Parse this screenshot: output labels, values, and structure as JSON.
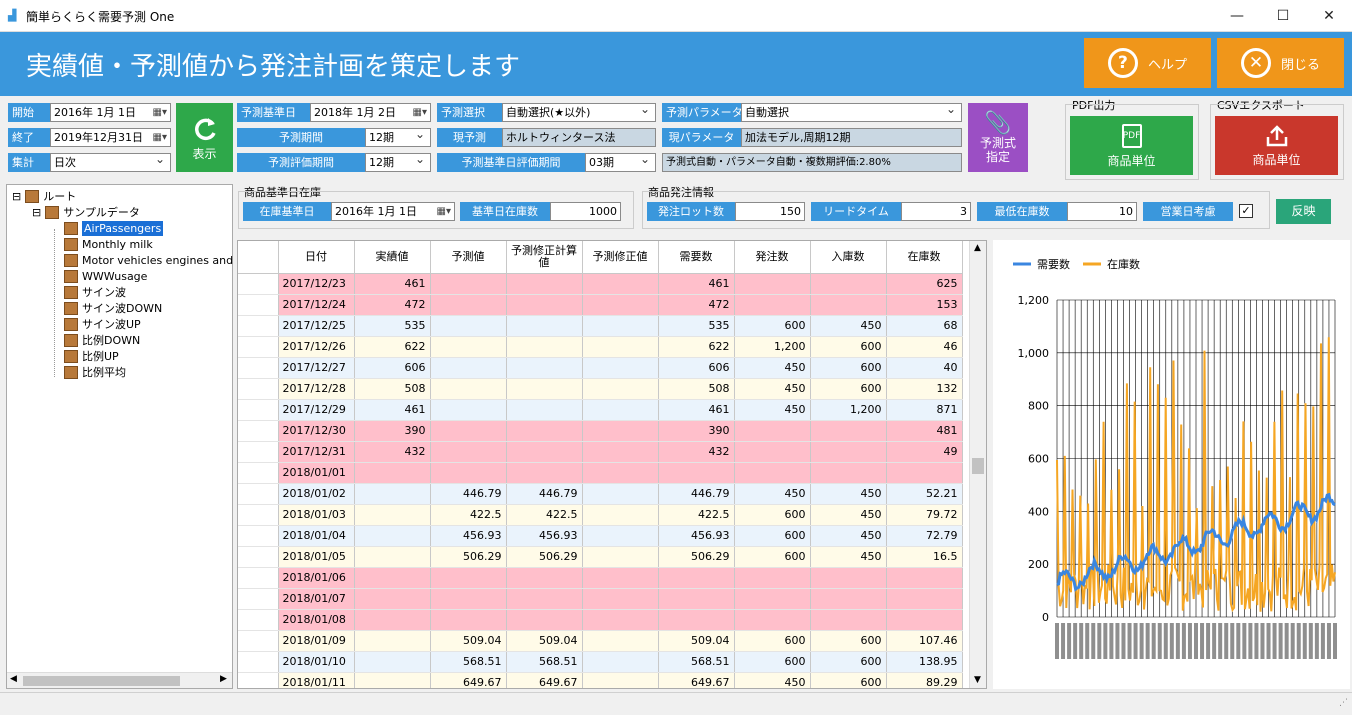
{
  "window": {
    "title": "簡単らくらく需要予測 One",
    "minimize": "—",
    "maximize": "☐",
    "close": "✕"
  },
  "header": {
    "title": "実績値・予測値から発注計画を策定します",
    "help_label": "ヘルプ",
    "close_label": "閉じる",
    "help_icon": "?",
    "close_icon": "✕"
  },
  "params": {
    "start_label": "開始",
    "start_value": "2016年  1月  1日",
    "end_label": "終了",
    "end_value": "2019年12月31日",
    "agg_label": "集計",
    "agg_value": "日次",
    "refresh_label": "表示",
    "forecast_base_label": "予測基準日",
    "forecast_base_value": "2018年  1月  2日",
    "forecast_period_label": "予測期間",
    "forecast_period_value": "12期",
    "eval_period_label": "予測評価期間",
    "eval_period_value": "12期",
    "forecast_select_label": "予測選択",
    "forecast_select_value": "自動選択(★以外)",
    "current_forecast_label": "現予測",
    "current_forecast_value": "ホルトウィンタース法",
    "base_eval_label": "予測基準日評価期間",
    "base_eval_value": "03期",
    "param_label": "予測パラメータ",
    "param_value": "自動選択",
    "current_param_label": "現パラメータ",
    "current_param_value": "加法モデル,周期12期",
    "formula_value": "予測式自動・パラメータ自動・複数期評価:2.80%",
    "formula_btn_label": "予測式\n指定",
    "pdf_group": "PDF出力",
    "pdf_btn": "商品単位",
    "csv_group": "CSVエクスポート",
    "csv_btn": "商品単位"
  },
  "stock": {
    "group": "商品基準日在庫",
    "date_label": "在庫基準日",
    "date_value": "2016年  1月  1日",
    "qty_label": "基準日在庫数",
    "qty_value": "1000"
  },
  "order": {
    "group": "商品発注情報",
    "lot_label": "発注ロット数",
    "lot_value": "150",
    "lead_label": "リードタイム",
    "lead_value": "3",
    "min_label": "最低在庫数",
    "min_value": "10",
    "biz_label": "営業日考慮",
    "apply_label": "反映"
  },
  "tree": {
    "root": "ルート",
    "child": "サンプルデータ",
    "items": [
      "AirPassengers",
      "Monthly milk",
      "Motor vehicles engines and p",
      "WWWusage",
      "サイン波",
      "サイン波DOWN",
      "サイン波UP",
      "比例DOWN",
      "比例UP",
      "比例平均"
    ]
  },
  "table": {
    "headers": [
      "日付",
      "実績値",
      "予測値",
      "予測修正計算値",
      "予測修正値",
      "需要数",
      "発注数",
      "入庫数",
      "在庫数"
    ],
    "rows": [
      [
        "2017/12/23",
        "461",
        "",
        "",
        "",
        "461",
        "",
        "",
        "625",
        "pink"
      ],
      [
        "2017/12/24",
        "472",
        "",
        "",
        "",
        "472",
        "",
        "",
        "153",
        "pink"
      ],
      [
        "2017/12/25",
        "535",
        "",
        "",
        "",
        "535",
        "600",
        "450",
        "68",
        "blue"
      ],
      [
        "2017/12/26",
        "622",
        "",
        "",
        "",
        "622",
        "1,200",
        "600",
        "46",
        "yel"
      ],
      [
        "2017/12/27",
        "606",
        "",
        "",
        "",
        "606",
        "450",
        "600",
        "40",
        "blue"
      ],
      [
        "2017/12/28",
        "508",
        "",
        "",
        "",
        "508",
        "450",
        "600",
        "132",
        "yel"
      ],
      [
        "2017/12/29",
        "461",
        "",
        "",
        "",
        "461",
        "450",
        "1,200",
        "871",
        "blue"
      ],
      [
        "2017/12/30",
        "390",
        "",
        "",
        "",
        "390",
        "",
        "",
        "481",
        "pink"
      ],
      [
        "2017/12/31",
        "432",
        "",
        "",
        "",
        "432",
        "",
        "",
        "49",
        "pink"
      ],
      [
        "2018/01/01",
        "",
        "",
        "",
        "",
        "",
        "",
        "",
        "",
        "pink"
      ],
      [
        "2018/01/02",
        "",
        "446.79",
        "446.79",
        "",
        "446.79",
        "450",
        "450",
        "52.21",
        "blue"
      ],
      [
        "2018/01/03",
        "",
        "422.5",
        "422.5",
        "",
        "422.5",
        "600",
        "450",
        "79.72",
        "yel"
      ],
      [
        "2018/01/04",
        "",
        "456.93",
        "456.93",
        "",
        "456.93",
        "600",
        "450",
        "72.79",
        "blue"
      ],
      [
        "2018/01/05",
        "",
        "506.29",
        "506.29",
        "",
        "506.29",
        "600",
        "450",
        "16.5",
        "yel"
      ],
      [
        "2018/01/06",
        "",
        "",
        "",
        "",
        "",
        "",
        "",
        "",
        "pink"
      ],
      [
        "2018/01/07",
        "",
        "",
        "",
        "",
        "",
        "",
        "",
        "",
        "pink"
      ],
      [
        "2018/01/08",
        "",
        "",
        "",
        "",
        "",
        "",
        "",
        "",
        "pink"
      ],
      [
        "2018/01/09",
        "",
        "509.04",
        "509.04",
        "",
        "509.04",
        "600",
        "600",
        "107.46",
        "yel"
      ],
      [
        "2018/01/10",
        "",
        "568.51",
        "568.51",
        "",
        "568.51",
        "600",
        "600",
        "138.95",
        "blue"
      ],
      [
        "2018/01/11",
        "",
        "649.67",
        "649.67",
        "",
        "649.67",
        "450",
        "600",
        "89.29",
        "yel"
      ]
    ]
  },
  "chart_data": {
    "type": "line",
    "legend_position": "top",
    "series": [
      {
        "name": "需要数",
        "color": "#3a86e0"
      },
      {
        "name": "在庫数",
        "color": "#f5a623"
      }
    ],
    "ylim": [
      0,
      1200
    ],
    "yticks": [
      "1,200",
      "1,000",
      "800",
      "600",
      "400",
      "200",
      "0"
    ]
  }
}
